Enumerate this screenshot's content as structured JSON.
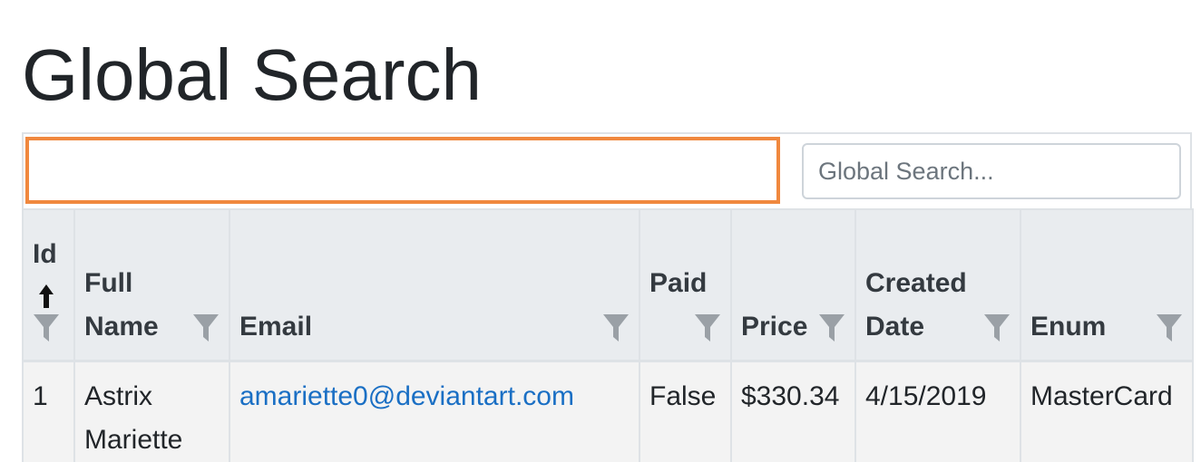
{
  "page": {
    "title": "Global Search"
  },
  "toolbar": {
    "search_placeholder": "Global Search...",
    "search_value": ""
  },
  "grid": {
    "columns": [
      {
        "key": "id",
        "label": "Id",
        "sorted": "ascending",
        "filterable": true
      },
      {
        "key": "full_name",
        "label": "Full Name",
        "filterable": true
      },
      {
        "key": "email",
        "label": "Email",
        "filterable": true
      },
      {
        "key": "paid",
        "label": "Paid",
        "filterable": true
      },
      {
        "key": "price",
        "label": "Price",
        "filterable": true
      },
      {
        "key": "created_date",
        "label": "Created Date",
        "filterable": true
      },
      {
        "key": "enum",
        "label": "Enum",
        "filterable": true
      }
    ],
    "rows": [
      {
        "id": "1",
        "full_name": "Astrix Mariette",
        "email": "amariette0@deviantart.com",
        "paid": "False",
        "price": "$330.34",
        "created_date": "4/15/2019",
        "enum": "MasterCard"
      }
    ]
  },
  "colors": {
    "header_bg": "#e9ecef",
    "row_bg": "#f3f3f3",
    "highlight": "#f0883e",
    "link": "#1a6fc4",
    "filter_icon": "#9aa0a6"
  }
}
